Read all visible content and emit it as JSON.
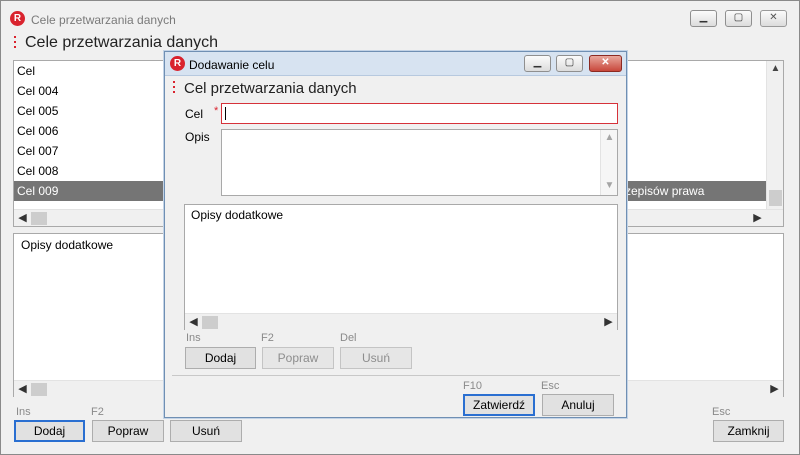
{
  "main": {
    "window_title": "Cele przetwarzania danych",
    "header_title": "Cele przetwarzania danych",
    "list": {
      "column_header": "Cel",
      "rows": [
        "Cel 004",
        "Cel 005",
        "Cel 006",
        "Cel 007",
        "Cel 008",
        "Cel 009"
      ],
      "selected_row_extra": "zepisów prawa"
    },
    "extras_label": "Opisy dodatkowe",
    "hints": {
      "add": "Ins",
      "edit": "F2",
      "close": "Esc"
    },
    "buttons": {
      "add": "Dodaj",
      "edit": "Popraw",
      "delete": "Usuń",
      "close": "Zamknij"
    }
  },
  "dialog": {
    "window_title": "Dodawanie celu",
    "header_title": "Cel przetwarzania danych",
    "cel_label": "Cel",
    "required_mark": "*",
    "cel_value": "",
    "opis_label": "Opis",
    "extras_label": "Opisy dodatkowe",
    "hints": {
      "add": "Ins",
      "edit": "F2",
      "delete": "Del",
      "confirm": "F10",
      "cancel": "Esc"
    },
    "buttons": {
      "add": "Dodaj",
      "edit": "Popraw",
      "delete": "Usuń",
      "confirm": "Zatwierdź",
      "cancel": "Anuluj"
    }
  },
  "colors": {
    "accent": "#d9232e",
    "selected_row": "#757575",
    "focus": "#2a6fd1"
  }
}
